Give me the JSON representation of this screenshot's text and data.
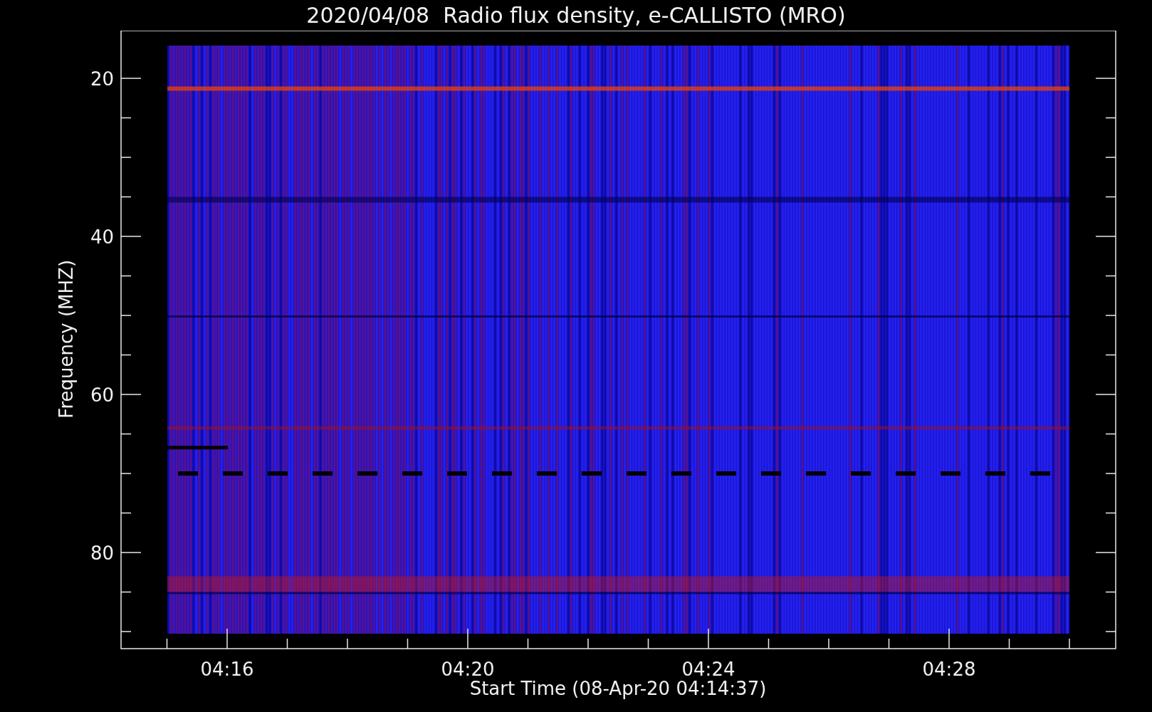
{
  "title": "2020/04/08  Radio flux density, e-CALLISTO (MRO)",
  "y_axis": {
    "label": "Frequency (MHZ)",
    "ticks": [
      "20",
      "40",
      "60",
      "80"
    ]
  },
  "x_axis": {
    "label": "Start Time (08-Apr-20 04:14:37)",
    "ticks": [
      "04:16",
      "04:20",
      "04:24",
      "04:28"
    ]
  }
}
